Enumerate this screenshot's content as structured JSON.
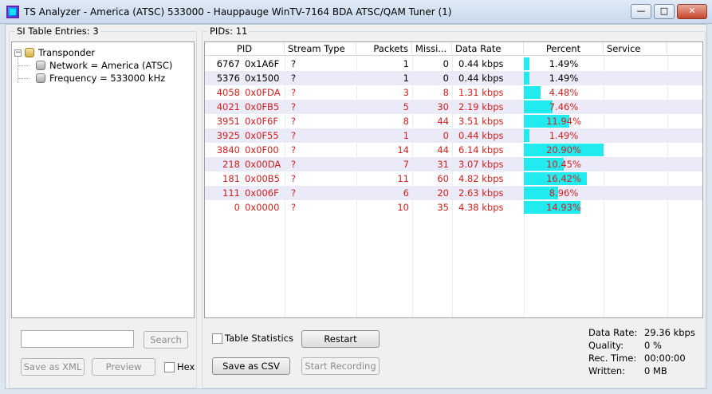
{
  "window": {
    "title": "TS Analyzer - America (ATSC) 533000 - Hauppauge WinTV-7164 BDA ATSC/QAM Tuner (1)",
    "minimize_glyph": "—",
    "maximize_glyph": "□",
    "close_glyph": "✕"
  },
  "left": {
    "group_label": "SI Table Entries: 3",
    "tree": {
      "expander": "−",
      "root": "Transponder",
      "children": [
        "Network = America (ATSC)",
        "Frequency = 533000 kHz"
      ]
    },
    "search_placeholder": "",
    "search_label": "Search",
    "save_xml_label": "Save as XML",
    "preview_label": "Preview",
    "hex_label": "Hex"
  },
  "right": {
    "group_label": "PIDs: 11",
    "columns": [
      "PID",
      "Stream Type",
      "Packets",
      "Missi...",
      "Data Rate",
      "Percent",
      "Service"
    ],
    "rows": [
      {
        "pid": "6767",
        "hex": "0x1A6F",
        "type": "?",
        "packets": "1",
        "missing": "0",
        "rate": "0.44 kbps",
        "percent": "1.49%",
        "pct": 1.49,
        "red": false
      },
      {
        "pid": "5376",
        "hex": "0x1500",
        "type": "?",
        "packets": "1",
        "missing": "0",
        "rate": "0.44 kbps",
        "percent": "1.49%",
        "pct": 1.49,
        "red": false
      },
      {
        "pid": "4058",
        "hex": "0x0FDA",
        "type": "?",
        "packets": "3",
        "missing": "8",
        "rate": "1.31 kbps",
        "percent": "4.48%",
        "pct": 4.48,
        "red": true
      },
      {
        "pid": "4021",
        "hex": "0x0FB5",
        "type": "?",
        "packets": "5",
        "missing": "30",
        "rate": "2.19 kbps",
        "percent": "7.46%",
        "pct": 7.46,
        "red": true
      },
      {
        "pid": "3951",
        "hex": "0x0F6F",
        "type": "?",
        "packets": "8",
        "missing": "44",
        "rate": "3.51 kbps",
        "percent": "11.94%",
        "pct": 11.94,
        "red": true
      },
      {
        "pid": "3925",
        "hex": "0x0F55",
        "type": "?",
        "packets": "1",
        "missing": "0",
        "rate": "0.44 kbps",
        "percent": "1.49%",
        "pct": 1.49,
        "red": true
      },
      {
        "pid": "3840",
        "hex": "0x0F00",
        "type": "?",
        "packets": "14",
        "missing": "44",
        "rate": "6.14 kbps",
        "percent": "20.90%",
        "pct": 20.9,
        "red": true
      },
      {
        "pid": "218",
        "hex": "0x00DA",
        "type": "?",
        "packets": "7",
        "missing": "31",
        "rate": "3.07 kbps",
        "percent": "10.45%",
        "pct": 10.45,
        "red": true
      },
      {
        "pid": "181",
        "hex": "0x00B5",
        "type": "?",
        "packets": "11",
        "missing": "60",
        "rate": "4.82 kbps",
        "percent": "16.42%",
        "pct": 16.42,
        "red": true
      },
      {
        "pid": "111",
        "hex": "0x006F",
        "type": "?",
        "packets": "6",
        "missing": "20",
        "rate": "2.63 kbps",
        "percent": "8.96%",
        "pct": 8.96,
        "red": true
      },
      {
        "pid": "0",
        "hex": "0x0000",
        "type": "?",
        "packets": "10",
        "missing": "35",
        "rate": "4.38 kbps",
        "percent": "14.93%",
        "pct": 14.93,
        "red": true
      }
    ],
    "table_stats_label": "Table Statistics",
    "restart_label": "Restart",
    "save_csv_label": "Save as CSV",
    "start_recording_label": "Start Recording",
    "stats": [
      {
        "label": "Data Rate:",
        "value": "29.36 kbps"
      },
      {
        "label": "Quality:",
        "value": "0 %"
      },
      {
        "label": "Rec. Time:",
        "value": "00:00:00"
      },
      {
        "label": "Written:",
        "value": "0 MB"
      }
    ]
  },
  "colors": {
    "percent_bar": "#22ebef",
    "highlight_text": "#d0201f",
    "alt_row": "#eaeaf8"
  }
}
